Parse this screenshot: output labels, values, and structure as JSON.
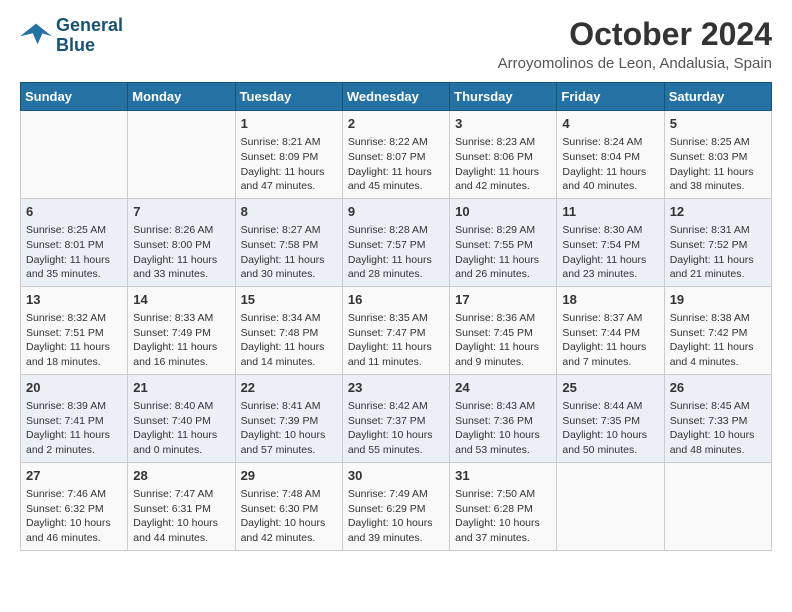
{
  "logo": {
    "line1": "General",
    "line2": "Blue"
  },
  "title": "October 2024",
  "location": "Arroyomolinos de Leon, Andalusia, Spain",
  "days_of_week": [
    "Sunday",
    "Monday",
    "Tuesday",
    "Wednesday",
    "Thursday",
    "Friday",
    "Saturday"
  ],
  "weeks": [
    [
      {
        "day": null,
        "info": null
      },
      {
        "day": null,
        "info": null
      },
      {
        "day": "1",
        "info": "Sunrise: 8:21 AM\nSunset: 8:09 PM\nDaylight: 11 hours and 47 minutes."
      },
      {
        "day": "2",
        "info": "Sunrise: 8:22 AM\nSunset: 8:07 PM\nDaylight: 11 hours and 45 minutes."
      },
      {
        "day": "3",
        "info": "Sunrise: 8:23 AM\nSunset: 8:06 PM\nDaylight: 11 hours and 42 minutes."
      },
      {
        "day": "4",
        "info": "Sunrise: 8:24 AM\nSunset: 8:04 PM\nDaylight: 11 hours and 40 minutes."
      },
      {
        "day": "5",
        "info": "Sunrise: 8:25 AM\nSunset: 8:03 PM\nDaylight: 11 hours and 38 minutes."
      }
    ],
    [
      {
        "day": "6",
        "info": "Sunrise: 8:25 AM\nSunset: 8:01 PM\nDaylight: 11 hours and 35 minutes."
      },
      {
        "day": "7",
        "info": "Sunrise: 8:26 AM\nSunset: 8:00 PM\nDaylight: 11 hours and 33 minutes."
      },
      {
        "day": "8",
        "info": "Sunrise: 8:27 AM\nSunset: 7:58 PM\nDaylight: 11 hours and 30 minutes."
      },
      {
        "day": "9",
        "info": "Sunrise: 8:28 AM\nSunset: 7:57 PM\nDaylight: 11 hours and 28 minutes."
      },
      {
        "day": "10",
        "info": "Sunrise: 8:29 AM\nSunset: 7:55 PM\nDaylight: 11 hours and 26 minutes."
      },
      {
        "day": "11",
        "info": "Sunrise: 8:30 AM\nSunset: 7:54 PM\nDaylight: 11 hours and 23 minutes."
      },
      {
        "day": "12",
        "info": "Sunrise: 8:31 AM\nSunset: 7:52 PM\nDaylight: 11 hours and 21 minutes."
      }
    ],
    [
      {
        "day": "13",
        "info": "Sunrise: 8:32 AM\nSunset: 7:51 PM\nDaylight: 11 hours and 18 minutes."
      },
      {
        "day": "14",
        "info": "Sunrise: 8:33 AM\nSunset: 7:49 PM\nDaylight: 11 hours and 16 minutes."
      },
      {
        "day": "15",
        "info": "Sunrise: 8:34 AM\nSunset: 7:48 PM\nDaylight: 11 hours and 14 minutes."
      },
      {
        "day": "16",
        "info": "Sunrise: 8:35 AM\nSunset: 7:47 PM\nDaylight: 11 hours and 11 minutes."
      },
      {
        "day": "17",
        "info": "Sunrise: 8:36 AM\nSunset: 7:45 PM\nDaylight: 11 hours and 9 minutes."
      },
      {
        "day": "18",
        "info": "Sunrise: 8:37 AM\nSunset: 7:44 PM\nDaylight: 11 hours and 7 minutes."
      },
      {
        "day": "19",
        "info": "Sunrise: 8:38 AM\nSunset: 7:42 PM\nDaylight: 11 hours and 4 minutes."
      }
    ],
    [
      {
        "day": "20",
        "info": "Sunrise: 8:39 AM\nSunset: 7:41 PM\nDaylight: 11 hours and 2 minutes."
      },
      {
        "day": "21",
        "info": "Sunrise: 8:40 AM\nSunset: 7:40 PM\nDaylight: 11 hours and 0 minutes."
      },
      {
        "day": "22",
        "info": "Sunrise: 8:41 AM\nSunset: 7:39 PM\nDaylight: 10 hours and 57 minutes."
      },
      {
        "day": "23",
        "info": "Sunrise: 8:42 AM\nSunset: 7:37 PM\nDaylight: 10 hours and 55 minutes."
      },
      {
        "day": "24",
        "info": "Sunrise: 8:43 AM\nSunset: 7:36 PM\nDaylight: 10 hours and 53 minutes."
      },
      {
        "day": "25",
        "info": "Sunrise: 8:44 AM\nSunset: 7:35 PM\nDaylight: 10 hours and 50 minutes."
      },
      {
        "day": "26",
        "info": "Sunrise: 8:45 AM\nSunset: 7:33 PM\nDaylight: 10 hours and 48 minutes."
      }
    ],
    [
      {
        "day": "27",
        "info": "Sunrise: 7:46 AM\nSunset: 6:32 PM\nDaylight: 10 hours and 46 minutes."
      },
      {
        "day": "28",
        "info": "Sunrise: 7:47 AM\nSunset: 6:31 PM\nDaylight: 10 hours and 44 minutes."
      },
      {
        "day": "29",
        "info": "Sunrise: 7:48 AM\nSunset: 6:30 PM\nDaylight: 10 hours and 42 minutes."
      },
      {
        "day": "30",
        "info": "Sunrise: 7:49 AM\nSunset: 6:29 PM\nDaylight: 10 hours and 39 minutes."
      },
      {
        "day": "31",
        "info": "Sunrise: 7:50 AM\nSunset: 6:28 PM\nDaylight: 10 hours and 37 minutes."
      },
      {
        "day": null,
        "info": null
      },
      {
        "day": null,
        "info": null
      }
    ]
  ]
}
